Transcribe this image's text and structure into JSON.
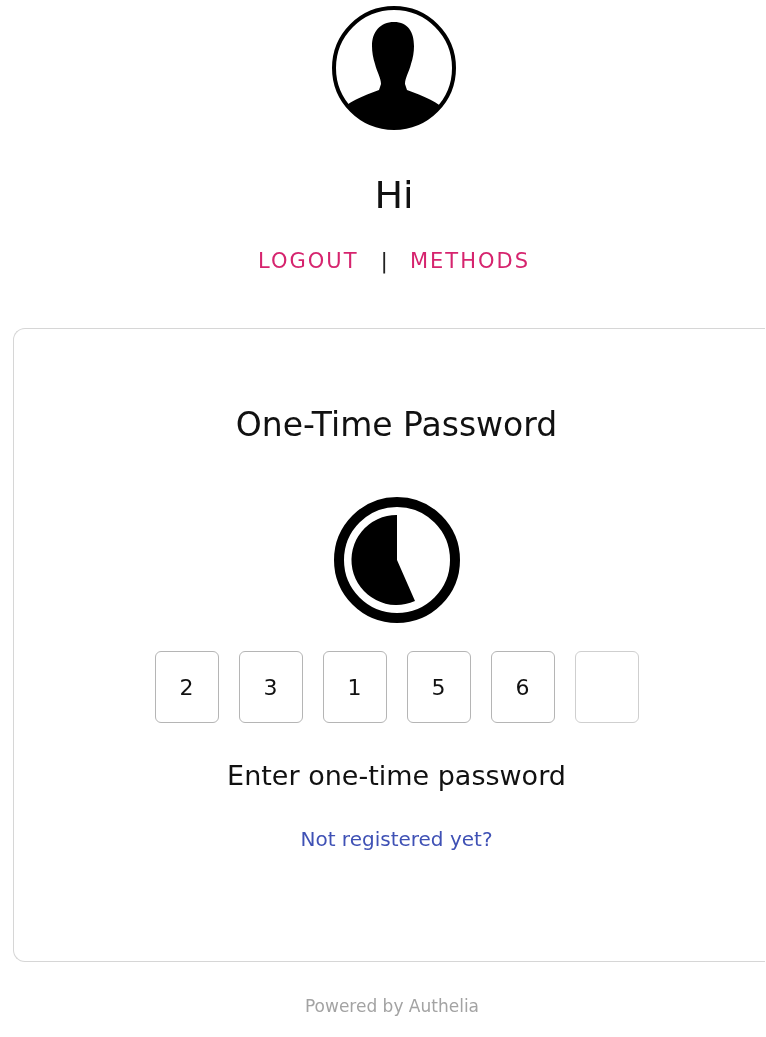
{
  "greeting": "Hi",
  "links": [
    {
      "label": "LOGOUT"
    },
    {
      "label": "METHODS"
    }
  ],
  "separator": "|",
  "card": {
    "title": "One-Time Password",
    "otp_fields": [
      {
        "filled": true,
        "value": "2"
      },
      {
        "filled": true,
        "value": "3"
      },
      {
        "filled": true,
        "value": "1"
      },
      {
        "filled": true,
        "value": "5"
      },
      {
        "filled": true,
        "value": "6"
      },
      {
        "filled": false
      }
    ],
    "instruction": "Enter one-time password",
    "register_link": "Not registered yet?"
  },
  "footer": "Powered by Authelia"
}
